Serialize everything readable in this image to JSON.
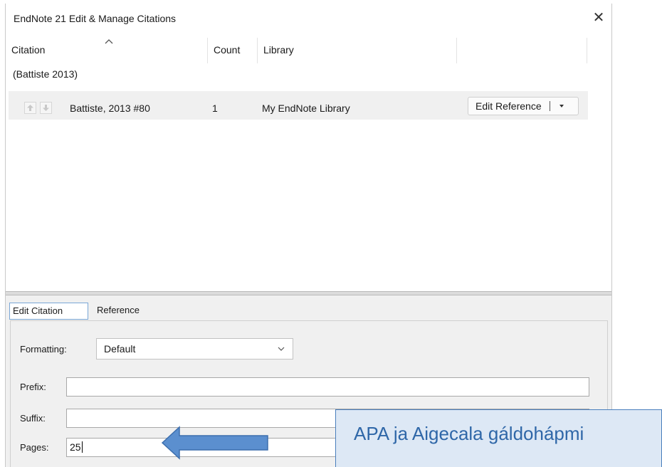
{
  "window": {
    "title": "EndNote 21 Edit & Manage Citations",
    "close_symbol": "✕"
  },
  "columns": {
    "citation": "Citation",
    "count": "Count",
    "library": "Library"
  },
  "group": {
    "label": "(Battiste 2013)"
  },
  "row": {
    "citation": "Battiste, 2013 #80",
    "count": "1",
    "library": "My EndNote Library",
    "action_label": "Edit Reference"
  },
  "tabs": {
    "edit_citation": "Edit Citation",
    "reference": "Reference"
  },
  "form": {
    "formatting_label": "Formatting:",
    "formatting_value": "Default",
    "prefix_label": "Prefix:",
    "prefix_value": "",
    "suffix_label": "Suffix:",
    "suffix_value": "",
    "pages_label": "Pages:",
    "pages_value": "25"
  },
  "annotation": {
    "text": "APA ja Aigecala gáldohápmi"
  },
  "colors": {
    "callout_fill": "#dde8f5",
    "callout_border": "#4a7fbd",
    "callout_text": "#2f67a8",
    "arrow_fill": "#5b8fcf",
    "active_tab_border": "#7aa7d6"
  },
  "icons": {
    "sort": "sort-ascending-icon",
    "move_up": "arrow-up-icon",
    "move_down": "arrow-down-icon",
    "dropdown": "chevron-down-icon",
    "close": "close-icon"
  }
}
